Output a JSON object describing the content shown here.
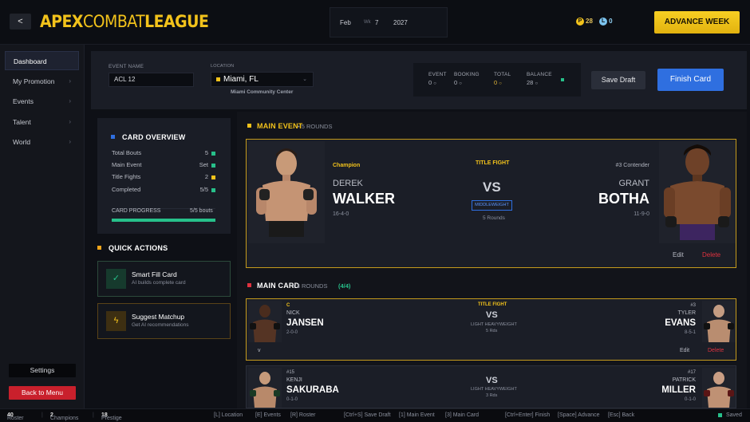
{
  "header": {
    "back_label": "<",
    "logo_bold": "APEX",
    "logo_thin": "COMBAT",
    "logo_bold2": "LEAGUE",
    "date": {
      "month": "Feb",
      "wk_label": "Wk",
      "week": "7",
      "year": "2027"
    },
    "currency_p": "28",
    "currency_l": "0",
    "advance_label": "ADVANCE WEEK"
  },
  "sidebar": {
    "items": [
      {
        "label": "Dashboard",
        "chevron": ""
      },
      {
        "label": "My Promotion",
        "chevron": "›"
      },
      {
        "label": "Events",
        "chevron": "›"
      },
      {
        "label": "Talent",
        "chevron": "›"
      },
      {
        "label": "World",
        "chevron": "›"
      }
    ],
    "settings_label": "Settings",
    "back_menu_label": "Back to Menu"
  },
  "event": {
    "name_label": "EVENT NAME",
    "name_value": "ACL 12",
    "location_label": "LOCATION",
    "location_value": "Miami, FL",
    "venue": "Miami Community Center",
    "stats": [
      {
        "label": "EVENT",
        "value": "0"
      },
      {
        "label": "BOOKING",
        "value": "0"
      },
      {
        "label": "TOTAL",
        "value": "0"
      },
      {
        "label": "BALANCE",
        "value": "28"
      }
    ],
    "save_draft_label": "Save Draft",
    "finish_label": "Finish Card"
  },
  "overview": {
    "title": "CARD OVERVIEW",
    "rows": [
      {
        "label": "Total Bouts",
        "value": "5"
      },
      {
        "label": "Main Event",
        "value": "Set"
      },
      {
        "label": "Title Fights",
        "value": "2"
      },
      {
        "label": "Completed",
        "value": "5/5"
      }
    ],
    "progress_label": "CARD PROGRESS",
    "progress_value": "5/5 bouts",
    "progress_fraction": 1.0
  },
  "quick_actions": {
    "title": "QUICK ACTIONS",
    "items": [
      {
        "title": "Smart Fill Card",
        "sub": "AI builds complete card"
      },
      {
        "title": "Suggest Matchup",
        "sub": "Get AI recommendations"
      }
    ]
  },
  "main_event": {
    "title": "MAIN EVENT",
    "rounds": "5 ROUNDS",
    "left": {
      "tag": "Champion",
      "first": "DEREK",
      "last": "WALKER",
      "record": "16-4-0"
    },
    "right": {
      "tag": "#3 Contender",
      "first": "GRANT",
      "last": "BOTHA",
      "record": "11-9-0"
    },
    "fight_type": "TITLE FIGHT",
    "vs": "VS",
    "division": "MIDDLEWEIGHT",
    "rounds_small": "5 Rounds",
    "edit_label": "Edit",
    "delete_label": "Delete"
  },
  "main_card": {
    "title": "MAIN CARD",
    "rounds": "3 ROUNDS",
    "count": "(4/4)",
    "bouts": [
      {
        "left": {
          "tag": "C",
          "first": "NICK",
          "last": "JANSEN",
          "record": "2-0-0"
        },
        "right": {
          "tag": "#3",
          "first": "TYLER",
          "last": "EVANS",
          "record": "8-5-1"
        },
        "fight_type": "TITLE FIGHT",
        "vs": "VS",
        "division": "LIGHT HEAVYWEIGHT",
        "rounds": "5 Rds",
        "expand": "v",
        "edit_label": "Edit",
        "delete_label": "Delete"
      },
      {
        "left": {
          "tag": "#15",
          "first": "KENJI",
          "last": "SAKURABA",
          "record": "0-1-0"
        },
        "right": {
          "tag": "#17",
          "first": "PATRICK",
          "last": "MILLER",
          "record": "0-1-0"
        },
        "fight_type": "",
        "vs": "VS",
        "division": "LIGHT HEAVYWEIGHT",
        "rounds": "3 Rds"
      }
    ]
  },
  "statusbar": {
    "roster_label": "Roster",
    "roster_value": "40",
    "champions_label": "Champions",
    "champions_value": "2",
    "prestige_label": "Prestige",
    "prestige_value": "18",
    "shortcuts": [
      "[L] Location",
      "[E] Events",
      "[R] Roster",
      "[Ctrl+S] Save Draft",
      "[1] Main Event",
      "[3] Main Card",
      "[Ctrl+Enter] Finish",
      "[Space] Advance",
      "[Esc] Back"
    ],
    "saved_label": "Saved"
  },
  "colors": {
    "accent_gold": "#f2c21b",
    "accent_blue": "#2f6fe0",
    "danger_red": "#c9202c",
    "success_green": "#27c08a"
  }
}
